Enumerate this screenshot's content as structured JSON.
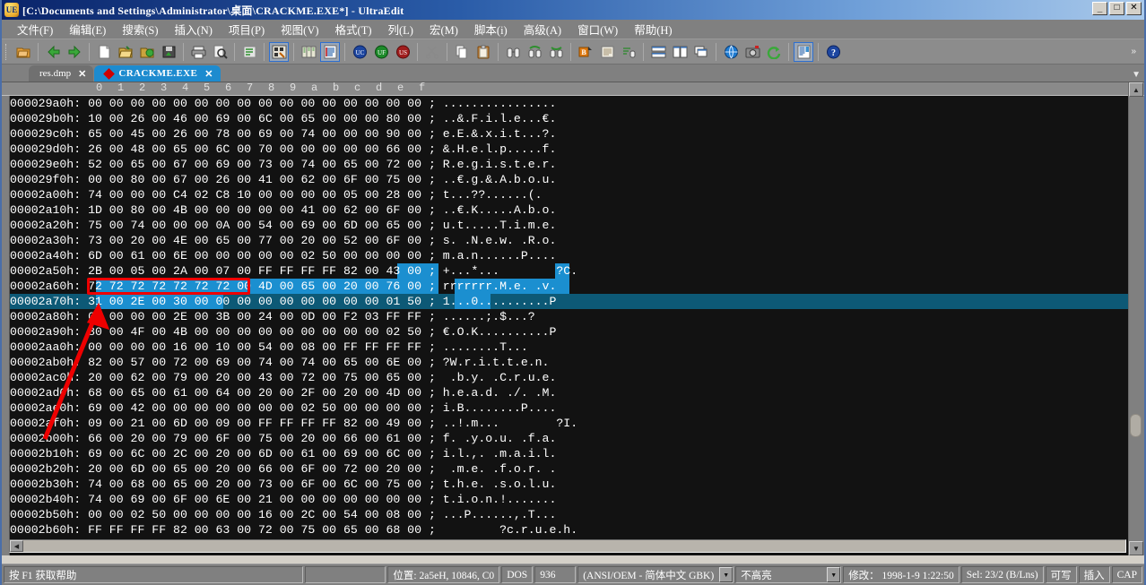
{
  "window": {
    "title": "[C:\\Documents and Settings\\Administrator\\桌面\\CRACKME.EXE*] - UltraEdit",
    "app_icon": "ue",
    "minimize": "_",
    "maximize": "□",
    "close": "✕"
  },
  "menu": [
    {
      "label": "文件(F)",
      "name": "menu-file"
    },
    {
      "label": "编辑(E)",
      "name": "menu-edit"
    },
    {
      "label": "搜索(S)",
      "name": "menu-search"
    },
    {
      "label": "插入(N)",
      "name": "menu-insert"
    },
    {
      "label": "项目(P)",
      "name": "menu-project"
    },
    {
      "label": "视图(V)",
      "name": "menu-view"
    },
    {
      "label": "格式(T)",
      "name": "menu-format"
    },
    {
      "label": "列(L)",
      "name": "menu-column"
    },
    {
      "label": "宏(M)",
      "name": "menu-macro"
    },
    {
      "label": "脚本(i)",
      "name": "menu-script"
    },
    {
      "label": "高级(A)",
      "name": "menu-advanced"
    },
    {
      "label": "窗口(W)",
      "name": "menu-window"
    },
    {
      "label": "帮助(H)",
      "name": "menu-help"
    }
  ],
  "toolbar": {
    "overflow_chevron": "»",
    "items": [
      {
        "name": "new-project-icon",
        "kind": "folder-orange",
        "selected": false
      },
      {
        "name": "back-arrow-icon",
        "kind": "arrow-left-green",
        "selected": false
      },
      {
        "name": "forward-arrow-icon",
        "kind": "arrow-right-green",
        "selected": false
      },
      {
        "name": "new-file-icon",
        "kind": "page-white",
        "selected": false
      },
      {
        "name": "open-file-icon",
        "kind": "folder-open",
        "selected": false
      },
      {
        "name": "open-folder-icon",
        "kind": "folder-green",
        "selected": false
      },
      {
        "name": "save-icon",
        "kind": "save-disk",
        "selected": false
      },
      {
        "name": "print-icon",
        "kind": "printer",
        "selected": false
      },
      {
        "name": "print-preview-icon",
        "kind": "magnifier-page",
        "selected": false
      },
      {
        "name": "word-wrap-icon",
        "kind": "lines-green",
        "selected": false
      },
      {
        "name": "hex-edit-icon",
        "kind": "hex-mode",
        "selected": true
      },
      {
        "name": "column-mode-icon",
        "kind": "columns",
        "selected": false
      },
      {
        "name": "list-view-icon",
        "kind": "list-lines",
        "selected": true
      },
      {
        "name": "uc-icon",
        "kind": "circle-blue-UC",
        "selected": false
      },
      {
        "name": "uf-icon",
        "kind": "circle-green-UF",
        "selected": false
      },
      {
        "name": "us-icon",
        "kind": "circle-red-US",
        "selected": false
      },
      {
        "name": "cut-icon",
        "kind": "scissors",
        "selected": false
      },
      {
        "name": "copy-icon",
        "kind": "copy-pages",
        "selected": false
      },
      {
        "name": "paste-icon",
        "kind": "clipboard",
        "selected": false
      },
      {
        "name": "find-icon",
        "kind": "binoculars",
        "selected": false
      },
      {
        "name": "find-prev-icon",
        "kind": "binoculars-up",
        "selected": false
      },
      {
        "name": "find-next-icon",
        "kind": "binoculars-down",
        "selected": false
      },
      {
        "name": "bold-icon",
        "kind": "bold-B",
        "selected": false
      },
      {
        "name": "indent-icon",
        "kind": "paragraph",
        "selected": false
      },
      {
        "name": "sort-icon",
        "kind": "sort-lines",
        "selected": false
      },
      {
        "name": "tile-horizontal-icon",
        "kind": "win-horiz",
        "selected": false
      },
      {
        "name": "tile-vertical-icon",
        "kind": "win-vert",
        "selected": false
      },
      {
        "name": "cascade-icon",
        "kind": "win-cascade",
        "selected": false
      },
      {
        "name": "browser-icon",
        "kind": "globe",
        "selected": false
      },
      {
        "name": "screenshot-icon",
        "kind": "camera",
        "selected": false
      },
      {
        "name": "refresh-icon",
        "kind": "refresh-green",
        "selected": false
      },
      {
        "name": "file-view-icon",
        "kind": "panel-blue",
        "selected": true
      },
      {
        "name": "help-icon",
        "kind": "help-question",
        "selected": false
      }
    ]
  },
  "tabs": [
    {
      "label": "res.dmp",
      "close": "✕",
      "active": false,
      "modified": false
    },
    {
      "label": "CRACKME.EXE",
      "close": "✕",
      "active": true,
      "modified": true
    }
  ],
  "editor": {
    "ruler": [
      "0",
      "1",
      "2",
      "3",
      "4",
      "5",
      "6",
      "7",
      "8",
      "9",
      "a",
      "b",
      "c",
      "d",
      "e",
      "f"
    ],
    "separator": ";",
    "current_line_index": 13,
    "lines": [
      {
        "addr": "000029a0h:",
        "bytes": [
          "00",
          "00",
          "00",
          "00",
          "00",
          "00",
          "00",
          "00",
          "00",
          "00",
          "00",
          "00",
          "00",
          "00",
          "00",
          "00"
        ],
        "ascii": "................"
      },
      {
        "addr": "000029b0h:",
        "bytes": [
          "10",
          "00",
          "26",
          "00",
          "46",
          "00",
          "69",
          "00",
          "6C",
          "00",
          "65",
          "00",
          "00",
          "00",
          "80",
          "00"
        ],
        "ascii": "..&.F.i.l.e...€."
      },
      {
        "addr": "000029c0h:",
        "bytes": [
          "65",
          "00",
          "45",
          "00",
          "26",
          "00",
          "78",
          "00",
          "69",
          "00",
          "74",
          "00",
          "00",
          "00",
          "90",
          "00"
        ],
        "ascii": "e.E.&.x.i.t...?."
      },
      {
        "addr": "000029d0h:",
        "bytes": [
          "26",
          "00",
          "48",
          "00",
          "65",
          "00",
          "6C",
          "00",
          "70",
          "00",
          "00",
          "00",
          "00",
          "00",
          "66",
          "00"
        ],
        "ascii": "&.H.e.l.p.....f."
      },
      {
        "addr": "000029e0h:",
        "bytes": [
          "52",
          "00",
          "65",
          "00",
          "67",
          "00",
          "69",
          "00",
          "73",
          "00",
          "74",
          "00",
          "65",
          "00",
          "72",
          "00"
        ],
        "ascii": "R.e.g.i.s.t.e.r."
      },
      {
        "addr": "000029f0h:",
        "bytes": [
          "00",
          "00",
          "80",
          "00",
          "67",
          "00",
          "26",
          "00",
          "41",
          "00",
          "62",
          "00",
          "6F",
          "00",
          "75",
          "00"
        ],
        "ascii": "..€.g.&.A.b.o.u."
      },
      {
        "addr": "00002a00h:",
        "bytes": [
          "74",
          "00",
          "00",
          "00",
          "C4",
          "02",
          "C8",
          "10",
          "00",
          "00",
          "00",
          "00",
          "05",
          "00",
          "28",
          "00"
        ],
        "ascii": "t...??......(."
      },
      {
        "addr": "00002a10h:",
        "bytes": [
          "1D",
          "00",
          "80",
          "00",
          "4B",
          "00",
          "00",
          "00",
          "00",
          "00",
          "41",
          "00",
          "62",
          "00",
          "6F",
          "00"
        ],
        "ascii": "..€.K.....A.b.o."
      },
      {
        "addr": "00002a20h:",
        "bytes": [
          "75",
          "00",
          "74",
          "00",
          "00",
          "00",
          "0A",
          "00",
          "54",
          "00",
          "69",
          "00",
          "6D",
          "00",
          "65",
          "00"
        ],
        "ascii": "u.t.....T.i.m.e."
      },
      {
        "addr": "00002a30h:",
        "bytes": [
          "73",
          "00",
          "20",
          "00",
          "4E",
          "00",
          "65",
          "00",
          "77",
          "00",
          "20",
          "00",
          "52",
          "00",
          "6F",
          "00"
        ],
        "ascii": "s. .N.e.w. .R.o."
      },
      {
        "addr": "00002a40h:",
        "bytes": [
          "6D",
          "00",
          "61",
          "00",
          "6E",
          "00",
          "00",
          "00",
          "00",
          "00",
          "02",
          "50",
          "00",
          "00",
          "00",
          "00"
        ],
        "ascii": "m.a.n......P...."
      },
      {
        "addr": "00002a50h:",
        "bytes": [
          "2B",
          "00",
          "05",
          "00",
          "2A",
          "00",
          "07",
          "00",
          "FF",
          "FF",
          "FF",
          "FF",
          "82",
          "00",
          "43",
          "00"
        ],
        "ascii": "+...*...        ?C."
      },
      {
        "addr": "00002a60h:",
        "bytes": [
          "72",
          "72",
          "72",
          "72",
          "72",
          "72",
          "72",
          "00",
          "4D",
          "00",
          "65",
          "00",
          "20",
          "00",
          "76",
          "00"
        ],
        "ascii": "rrrrrrr.M.e. .v."
      },
      {
        "addr": "00002a70h:",
        "bytes": [
          "31",
          "00",
          "2E",
          "00",
          "30",
          "00",
          "00",
          "00",
          "00",
          "00",
          "00",
          "00",
          "00",
          "00",
          "01",
          "50"
        ],
        "ascii": "1...0..........P"
      },
      {
        "addr": "00002a80h:",
        "bytes": [
          "00",
          "00",
          "00",
          "00",
          "2E",
          "00",
          "3B",
          "00",
          "24",
          "00",
          "0D",
          "00",
          "F2",
          "03",
          "FF",
          "FF"
        ],
        "ascii": "......;.$...?"
      },
      {
        "addr": "00002a90h:",
        "bytes": [
          "80",
          "00",
          "4F",
          "00",
          "4B",
          "00",
          "00",
          "00",
          "00",
          "00",
          "00",
          "00",
          "00",
          "00",
          "02",
          "50"
        ],
        "ascii": "€.O.K..........P"
      },
      {
        "addr": "00002aa0h:",
        "bytes": [
          "00",
          "00",
          "00",
          "00",
          "16",
          "00",
          "10",
          "00",
          "54",
          "00",
          "08",
          "00",
          "FF",
          "FF",
          "FF",
          "FF"
        ],
        "ascii": "........T..."
      },
      {
        "addr": "00002ab0h:",
        "bytes": [
          "82",
          "00",
          "57",
          "00",
          "72",
          "00",
          "69",
          "00",
          "74",
          "00",
          "74",
          "00",
          "65",
          "00",
          "6E",
          "00"
        ],
        "ascii": "?W.r.i.t.t.e.n."
      },
      {
        "addr": "00002ac0h:",
        "bytes": [
          "20",
          "00",
          "62",
          "00",
          "79",
          "00",
          "20",
          "00",
          "43",
          "00",
          "72",
          "00",
          "75",
          "00",
          "65",
          "00"
        ],
        "ascii": " .b.y. .C.r.u.e."
      },
      {
        "addr": "00002ad0h:",
        "bytes": [
          "68",
          "00",
          "65",
          "00",
          "61",
          "00",
          "64",
          "00",
          "20",
          "00",
          "2F",
          "00",
          "20",
          "00",
          "4D",
          "00"
        ],
        "ascii": "h.e.a.d. ./. .M."
      },
      {
        "addr": "00002ae0h:",
        "bytes": [
          "69",
          "00",
          "42",
          "00",
          "00",
          "00",
          "00",
          "00",
          "00",
          "00",
          "02",
          "50",
          "00",
          "00",
          "00",
          "00"
        ],
        "ascii": "i.B........P...."
      },
      {
        "addr": "00002af0h:",
        "bytes": [
          "09",
          "00",
          "21",
          "00",
          "6D",
          "00",
          "09",
          "00",
          "FF",
          "FF",
          "FF",
          "FF",
          "82",
          "00",
          "49",
          "00"
        ],
        "ascii": "..!.m...        ?I."
      },
      {
        "addr": "00002b00h:",
        "bytes": [
          "66",
          "00",
          "20",
          "00",
          "79",
          "00",
          "6F",
          "00",
          "75",
          "00",
          "20",
          "00",
          "66",
          "00",
          "61",
          "00"
        ],
        "ascii": "f. .y.o.u. .f.a."
      },
      {
        "addr": "00002b10h:",
        "bytes": [
          "69",
          "00",
          "6C",
          "00",
          "2C",
          "00",
          "20",
          "00",
          "6D",
          "00",
          "61",
          "00",
          "69",
          "00",
          "6C",
          "00"
        ],
        "ascii": "i.l.,. .m.a.i.l."
      },
      {
        "addr": "00002b20h:",
        "bytes": [
          "20",
          "00",
          "6D",
          "00",
          "65",
          "00",
          "20",
          "00",
          "66",
          "00",
          "6F",
          "00",
          "72",
          "00",
          "20",
          "00"
        ],
        "ascii": " .m.e. .f.o.r. ."
      },
      {
        "addr": "00002b30h:",
        "bytes": [
          "74",
          "00",
          "68",
          "00",
          "65",
          "00",
          "20",
          "00",
          "73",
          "00",
          "6F",
          "00",
          "6C",
          "00",
          "75",
          "00"
        ],
        "ascii": "t.h.e. .s.o.l.u."
      },
      {
        "addr": "00002b40h:",
        "bytes": [
          "74",
          "00",
          "69",
          "00",
          "6F",
          "00",
          "6E",
          "00",
          "21",
          "00",
          "00",
          "00",
          "00",
          "00",
          "00",
          "00"
        ],
        "ascii": "t.i.o.n.!......."
      },
      {
        "addr": "00002b50h:",
        "bytes": [
          "00",
          "00",
          "02",
          "50",
          "00",
          "00",
          "00",
          "00",
          "16",
          "00",
          "2C",
          "00",
          "54",
          "00",
          "08",
          "00"
        ],
        "ascii": "...P......,.T..."
      },
      {
        "addr": "00002b60h:",
        "bytes": [
          "FF",
          "FF",
          "FF",
          "FF",
          "82",
          "00",
          "63",
          "00",
          "72",
          "00",
          "75",
          "00",
          "65",
          "00",
          "68",
          "00"
        ],
        "ascii": "        ?c.r.u.e.h."
      }
    ]
  },
  "annotations": {
    "rect_label": "highlighted-bytes-72",
    "arrow_label": "red-pointer-arrow"
  },
  "statusbar": {
    "help_hint": "按 F1 获取帮助",
    "spacer": "",
    "position": "位置: 2a5eH, 10846, C0",
    "line_ending": "DOS",
    "codepage": "936",
    "encoding": "(ANSI/OEM - 简体中文 GBK)",
    "highlight": "不高亮",
    "modified": "修改： 1998-1-9 1:22:50",
    "selection": "Sel: 23/2 (B/Lns)",
    "writable": "可写",
    "insert": "插入",
    "caps": "CAP",
    "dropdown_glyph": "▼"
  },
  "colors": {
    "title_start": "#0a246a",
    "title_end": "#a8c8ea",
    "menu_bg": "#808080",
    "toolbar_bg": "#8c8c8c",
    "editor_bg": "#121212",
    "selection_blue": "#1b8fd0",
    "current_line": "#0d5976",
    "tab_active": "#1d8bcf",
    "annotation_red": "#ee0000",
    "text_white": "#ffffff"
  }
}
